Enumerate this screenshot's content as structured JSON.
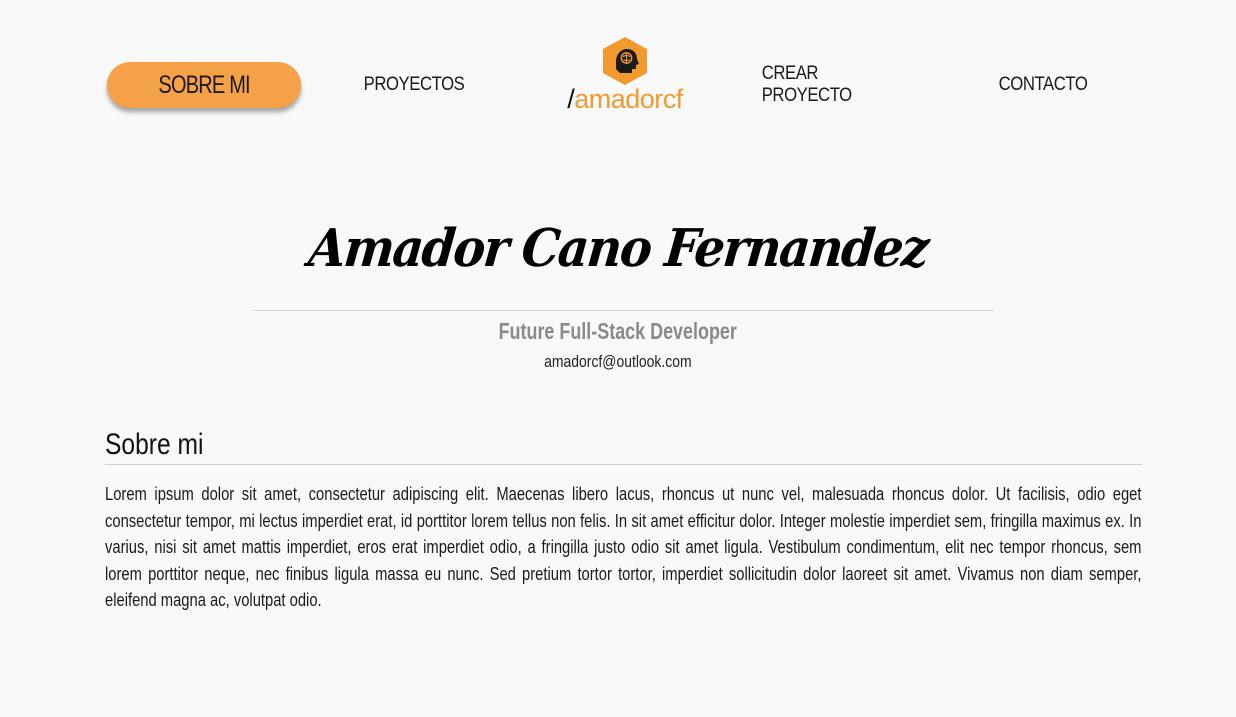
{
  "nav": {
    "items": [
      {
        "label": "SOBRE MI",
        "active": true
      },
      {
        "label": "PROYECTOS",
        "active": false
      },
      {
        "label": "CREAR PROYECTO",
        "active": false
      },
      {
        "label": "CONTACTO",
        "active": false
      }
    ]
  },
  "logo": {
    "icon": "brain-head-hexagon-icon",
    "slash": "/",
    "name": "amadorcf"
  },
  "hero": {
    "name": "Amador Cano Fernandez",
    "role": "Future Full-Stack Developer",
    "email": "amadorcf@outlook.com"
  },
  "about": {
    "heading": "Sobre mi",
    "text": "Lorem ipsum dolor sit amet, consectetur adipiscing elit. Maecenas libero lacus, rhoncus ut nunc vel, malesuada rhoncus dolor. Ut facilisis, odio eget consectetur tempor, mi lectus imperdiet erat, id porttitor lorem tellus non felis. In sit amet efficitur dolor. Integer molestie imperdiet sem, fringilla maximus ex. In varius, nisi sit amet mattis imperdiet, eros erat imperdiet odio, a fringilla justo odio sit amet ligula. Vestibulum condimentum, elit nec tempor rhoncus, sem lorem porttitor neque, nec finibus ligula massa eu nunc. Sed pretium tortor tortor, imperdiet sollicitudin dolor laoreet sit amet. Vivamus non diam semper, eleifend magna ac, volutpat odio."
  },
  "colors": {
    "accent": "#f5a147",
    "logo_orange": "#f39a2e",
    "background": "#f9f9f9",
    "muted_text": "#8a8a8a"
  }
}
